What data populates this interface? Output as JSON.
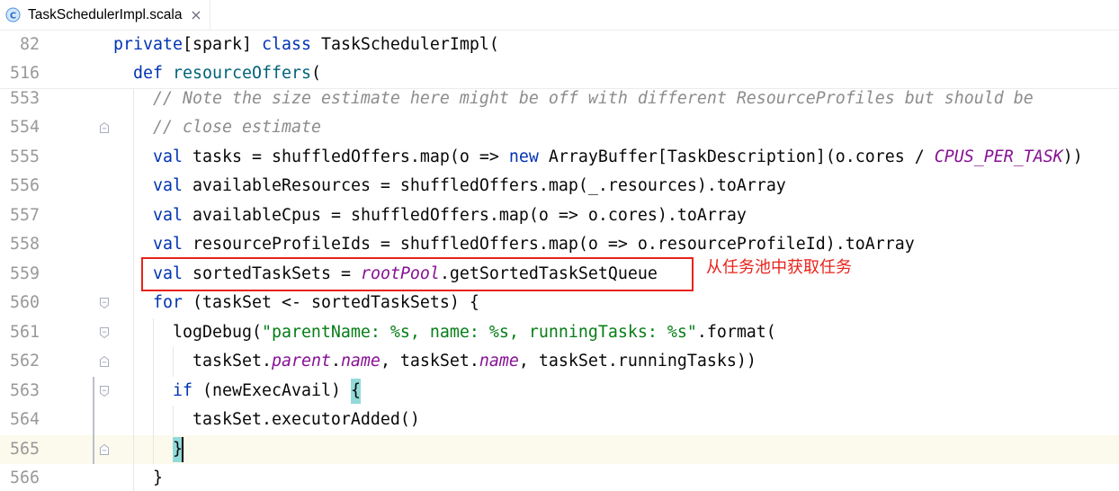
{
  "tab": {
    "icon": "scala-class-icon",
    "icon_letter": "C",
    "title": "TaskSchedulerImpl.scala",
    "close_glyph": "×"
  },
  "sticky_lines": [
    {
      "number": "82",
      "tokens": [
        {
          "kw": "private"
        },
        {
          "p": "[spark] "
        },
        {
          "kw": "class"
        },
        {
          "p": " TaskSchedulerImpl("
        }
      ]
    },
    {
      "number": "516",
      "tokens": [
        {
          "p": "  "
        },
        {
          "kw": "def"
        },
        {
          "p": " "
        },
        {
          "fn": "resourceOffers"
        },
        {
          "p": "("
        }
      ]
    }
  ],
  "lines": [
    {
      "number": "553",
      "tokens": [
        {
          "p": "    "
        },
        {
          "c": "// Note the size estimate here might be off with different ResourceProfiles but should be"
        }
      ]
    },
    {
      "number": "554",
      "fold_icon": "fold-end-icon",
      "tokens": [
        {
          "p": "    "
        },
        {
          "c": "// close estimate"
        }
      ]
    },
    {
      "number": "555",
      "tokens": [
        {
          "p": "    "
        },
        {
          "kw": "val"
        },
        {
          "p": " tasks = shuffledOffers.map(o => "
        },
        {
          "kw": "new"
        },
        {
          "p": " ArrayBuffer[TaskDescription](o.cores / "
        },
        {
          "const": "CPUS_PER_TASK"
        },
        {
          "p": "))"
        }
      ]
    },
    {
      "number": "556",
      "tokens": [
        {
          "p": "    "
        },
        {
          "kw": "val"
        },
        {
          "p": " availableResources = shuffledOffers.map(_.resources).toArray"
        }
      ]
    },
    {
      "number": "557",
      "tokens": [
        {
          "p": "    "
        },
        {
          "kw": "val"
        },
        {
          "p": " availableCpus = shuffledOffers.map(o => o.cores).toArray"
        }
      ]
    },
    {
      "number": "558",
      "tokens": [
        {
          "p": "    "
        },
        {
          "kw": "val"
        },
        {
          "p": " resourceProfileIds = shuffledOffers.map(o => o.resourceProfileId).toArray"
        }
      ]
    },
    {
      "number": "559",
      "tokens": [
        {
          "p": "    "
        },
        {
          "kw": "val"
        },
        {
          "p": " sortedTaskSets = "
        },
        {
          "field": "rootPool"
        },
        {
          "p": ".getSortedTaskSetQueue"
        }
      ]
    },
    {
      "number": "560",
      "fold_icon": "fold-start-icon",
      "tokens": [
        {
          "p": "    "
        },
        {
          "kw": "for"
        },
        {
          "p": " (taskSet <- sortedTaskSets) {"
        }
      ]
    },
    {
      "number": "561",
      "fold_icon": "fold-start-icon",
      "tokens": [
        {
          "p": "      logDebug("
        },
        {
          "s": "\"parentName: %s, name: %s, runningTasks: %s\""
        },
        {
          "p": ".format("
        }
      ]
    },
    {
      "number": "562",
      "fold_icon": "fold-end-icon",
      "tokens": [
        {
          "p": "        taskSet."
        },
        {
          "field": "parent"
        },
        {
          "p": "."
        },
        {
          "field": "name"
        },
        {
          "p": ", taskSet."
        },
        {
          "field": "name"
        },
        {
          "p": ", taskSet.runningTasks))"
        }
      ]
    },
    {
      "number": "563",
      "fold_icon": "fold-start-icon",
      "vcs_changed": true,
      "tokens": [
        {
          "p": "      "
        },
        {
          "kw": "if"
        },
        {
          "p": " (newExecAvail) "
        },
        {
          "brace": "{"
        }
      ]
    },
    {
      "number": "564",
      "vcs_changed": true,
      "tokens": [
        {
          "p": "        taskSet.executorAdded()"
        }
      ]
    },
    {
      "number": "565",
      "fold_icon": "fold-end-icon",
      "vcs_changed": true,
      "current": true,
      "caret": true,
      "tokens": [
        {
          "p": "      "
        },
        {
          "brace": "}"
        }
      ]
    },
    {
      "number": "566",
      "tokens": [
        {
          "p": "    }"
        }
      ]
    }
  ],
  "annotation": {
    "text": "从任务池中获取任务"
  },
  "colors": {
    "keyword": "#0033b3",
    "plain": "#080808",
    "comment": "#8c8c8c",
    "string": "#067d17",
    "field": "#871094",
    "method_declaration": "#00627a",
    "brace_match_background": "#93d9d9",
    "current_line_background": "#fcfaed",
    "line_number": "#999999",
    "annotation_red": "#e8231b",
    "vcs_modified": "#bcc0c8"
  }
}
